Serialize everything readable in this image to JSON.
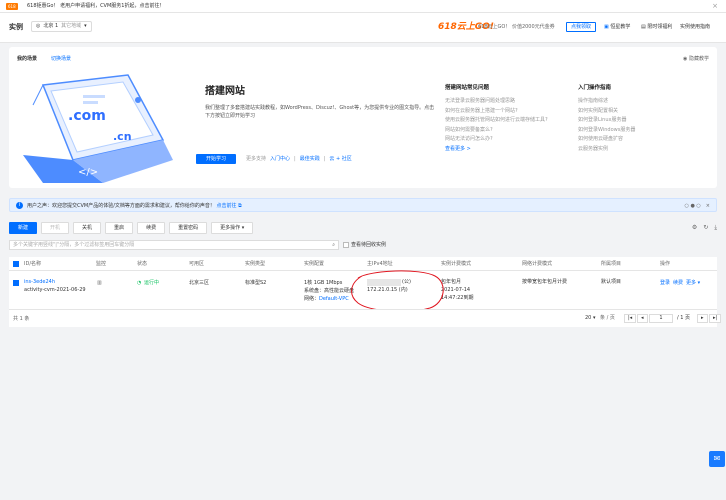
{
  "topbar": {
    "tag": "618",
    "notice": "618钜惠Go！ 老用户申请福利，CVM服务1折起，点击前往！"
  },
  "header": {
    "title": "实例",
    "region": "北京 1",
    "region_other": "其它地域",
    "banner618": "618云上GO!",
    "banner_text": "618云上GO！ 价值2000元代金券",
    "btn_apply": "点我领取",
    "link_docs": "恒星教学",
    "link_benefits": "限时领福利",
    "link_guide": "实例使用指南"
  },
  "scene": {
    "title_label": "我的场景",
    "switch_label": "切换场景",
    "hide_label": "隐藏教学",
    "heading": "搭建网站",
    "desc": "我们整理了多套搭建站实践教程，如WordPress、Discuz!、Ghost等，为您提供专业的图文指导。点击下方按钮立即开始学习",
    "start_btn": "开始学习",
    "more_label": "更多支持",
    "links": [
      "入门中心",
      "最佳实践",
      "云 + 社区"
    ],
    "faq_title": "搭建网站常见问题",
    "faq_items": [
      "无法登录云服务器问题处理思路",
      "如何在云服务器上搭建一个网站?",
      "使用云服务器托管网站如何进行云端存储工具?",
      "网站如何需要备案么?",
      "网站无法访问怎么办?"
    ],
    "faq_more": "查看更多 >",
    "guide_title": "入门操作指南",
    "guide_items": [
      "操作指南综述",
      "如何实例配置相关",
      "如何登录Linux服务器",
      "如何登录Windows服务器",
      "如何使用云硬盘扩容",
      "云服务器实例"
    ]
  },
  "notice": {
    "text": "用户之声：欢迎您提交CVM产品的体验/文档等方面的需求和建议，帮你给你的声音！",
    "link": "点击前往"
  },
  "toolbar": {
    "new": "新建",
    "start": "开机",
    "stop": "关机",
    "restart": "重启",
    "renew": "续费",
    "reset_pwd": "重置密码",
    "more": "更多操作"
  },
  "search": {
    "placeholder": "多个关键字用竖线\"|\"分隔，多个过滤标签用回车键分隔",
    "recycle": "查看待回收实例"
  },
  "table": {
    "headers": [
      "ID/名称",
      "监控",
      "状态",
      "可用区",
      "实例类型",
      "实例配置",
      "主IPv4地址",
      "实例计费模式",
      "网络计费模式",
      "所属项目",
      "操作"
    ],
    "row": {
      "id": "ins-3ede24h",
      "name": "activity-cvm-2021-06-29",
      "status": "运行中",
      "zone": "北京三区",
      "type": "标准型S2",
      "config": "1核 1GB 1Mbps",
      "disk": "系统盘：高性能云硬盘",
      "network": "网络：",
      "vpc": "Default-VPC",
      "ip_public": "(公)",
      "ip_private": "172.21.0.15 (内)",
      "billing": "包年包月",
      "expire_date": "2021-07-14",
      "expire_time": "14:47:22到期",
      "net_billing": "按带宽包年包月计费",
      "project": "默认项目",
      "actions": [
        "登录",
        "续费",
        "更多"
      ]
    },
    "total": "共 1 条",
    "page_size": "20",
    "per_page": "条 / 页",
    "page": "1",
    "page_total": "/ 1 页"
  },
  "chat_icon": "chat-icon"
}
